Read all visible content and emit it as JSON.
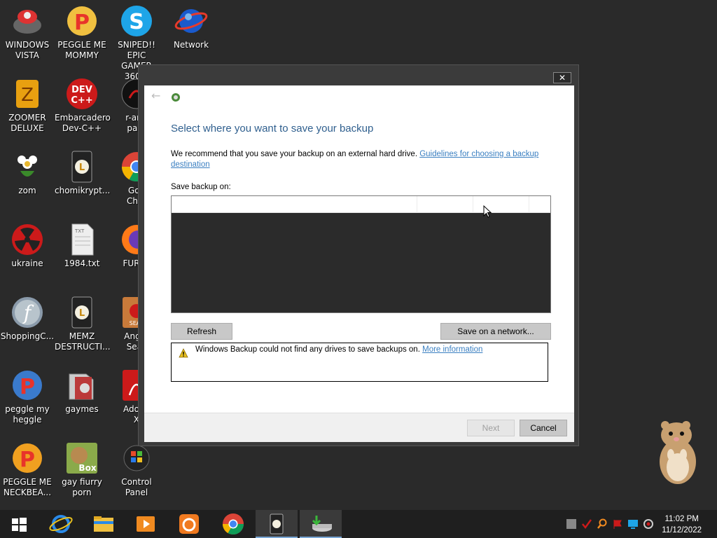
{
  "desktop": {
    "icons": [
      {
        "label": "WINDOWS\nVISTA"
      },
      {
        "label": "PEGGLE ME\nMOMMY"
      },
      {
        "label": "SNIPED!! EPIC\nGAMER 360..."
      },
      {
        "label": "Network"
      },
      {
        "label": "ZOOMER\nDELUXE"
      },
      {
        "label": "Embarcadero\nDev-C++"
      },
      {
        "label": "r-anti\npara"
      },
      {
        "label": "zom"
      },
      {
        "label": "chomikrypt..."
      },
      {
        "label": "Goo\nChro"
      },
      {
        "label": "ukraine"
      },
      {
        "label": "1984.txt"
      },
      {
        "label": "FURRY"
      },
      {
        "label": "ShoppingC..."
      },
      {
        "label": "MEMZ\nDESTRUCTI..."
      },
      {
        "label": "Angry\nSeas"
      },
      {
        "label": "peggle my\nheggle"
      },
      {
        "label": "gaymes"
      },
      {
        "label": "Adobe\nX"
      },
      {
        "label": "PEGGLE ME\nNECKBEA..."
      },
      {
        "label": "gay fiurry\nporn"
      },
      {
        "label": "Control Panel"
      }
    ]
  },
  "dialog": {
    "close_label": "✕",
    "heading": "Select where you want to save your backup",
    "recommend_text": "We recommend that you save your backup on an external hard drive.",
    "recommend_link": "Guidelines for choosing a backup destination",
    "save_on_label": "Save backup on:",
    "refresh_label": "Refresh",
    "save_network_label": "Save on a network...",
    "message": "Windows Backup could not find any drives to save backups on.",
    "message_link": "More information",
    "next_label": "Next",
    "cancel_label": "Cancel"
  },
  "taskbar": {
    "apps": [
      "start",
      "internet-explorer",
      "file-explorer",
      "media-player",
      "uc-browser",
      "chrome",
      "chomikrypt",
      "windows-backup"
    ],
    "time": "11:02 PM",
    "date": "11/12/2022"
  },
  "colors": {
    "desktop_bg": "#2a2a2a",
    "heading": "#2f5f8e",
    "link": "#3a7fc1"
  }
}
